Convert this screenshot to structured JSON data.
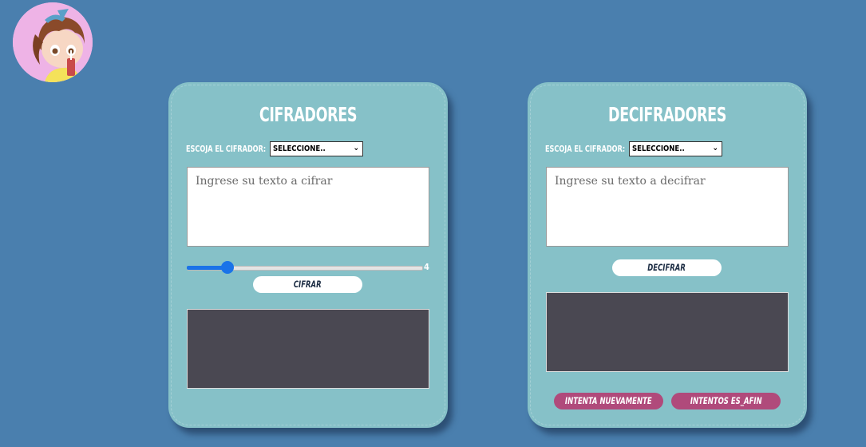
{
  "avatar": {
    "alt": "avatar"
  },
  "cipher_card": {
    "title": "CIFRADORES",
    "select_label": "ESCOJA EL CIFRADOR:",
    "select_value": "SELECCIONE..",
    "input_placeholder": "Ingrese su texto a cifrar",
    "slider_value": "4",
    "button_label": "CIFRAR"
  },
  "decipher_card": {
    "title": "DECIFRADORES",
    "select_label": "ESCOJA EL CIFRADOR:",
    "select_value": "SELECCIONE..",
    "input_placeholder": "Ingrese su texto a decifrar",
    "button_label": "DECIFRAR",
    "retry_label": "INTENTA NUEVAMENTE",
    "attempts_label": "INTENTOS ES_AFIN"
  },
  "colors": {
    "background": "#4a7fae",
    "card": "#86c1c8",
    "output": "#4a4852",
    "accent_pink": "#b04a7b",
    "slider_blue": "#1a73e8"
  }
}
